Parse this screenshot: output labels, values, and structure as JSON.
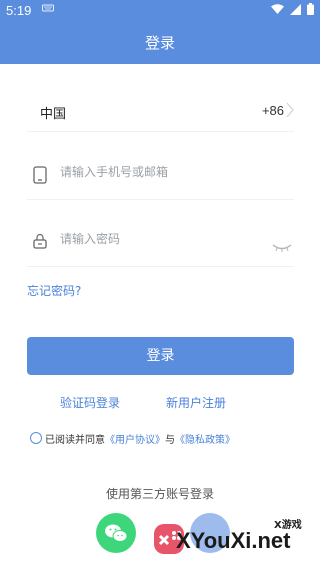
{
  "status_bar": {
    "time": "5:19",
    "icons": [
      "keyboard-icon",
      "wifi-icon",
      "signal-icon",
      "battery-icon"
    ]
  },
  "header": {
    "title": "登录"
  },
  "form": {
    "country_label": "中国",
    "country_code": "+86",
    "phone_placeholder": "请输入手机号或邮箱",
    "password_placeholder": "请输入密码",
    "forgot_password": "忘记密码?",
    "login_button": "登录"
  },
  "links": {
    "sms_login": "验证码登录",
    "register": "新用户注册"
  },
  "agreement": {
    "prefix": "已阅读并同意",
    "user_agreement": "《用户协议》",
    "and": "与",
    "privacy_policy": "《隐私政策》"
  },
  "third_party": {
    "title": "使用第三方账号登录"
  },
  "watermark": {
    "brand_cn": "X游戏",
    "brand": "XYouXi.net"
  },
  "colors": {
    "primary": "#5b8ddf",
    "link": "#4a82d9",
    "wechat": "#3dd67a"
  }
}
